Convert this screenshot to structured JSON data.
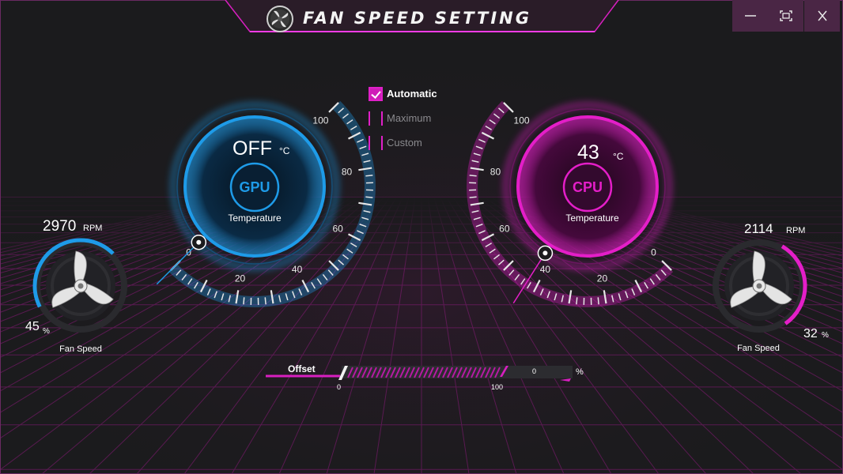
{
  "app": {
    "title": "Fan Speed Setting"
  },
  "window_controls": {
    "minimize": "—",
    "maximize": "▢",
    "close": "X"
  },
  "modes": [
    {
      "label": "Automatic",
      "checked": true
    },
    {
      "label": "Maximum",
      "checked": false
    },
    {
      "label": "Custom",
      "checked": false
    }
  ],
  "gpu": {
    "chip_label": "GPU",
    "temperature": "OFF",
    "temp_unit": "°C",
    "temperature_label": "Temperature",
    "gauge_ticks": [
      "0",
      "20",
      "40",
      "60",
      "80",
      "100"
    ],
    "needle_value": 0,
    "fan_rpm": "2970",
    "rpm_unit": "RPM",
    "fan_percent": "45",
    "percent_unit": "%",
    "fan_percent_value": 45,
    "fan_label": "Fan Speed",
    "color": "#1e9be8"
  },
  "cpu": {
    "chip_label": "CPU",
    "temperature": "43",
    "temp_unit": "°C",
    "temperature_label": "Temperature",
    "gauge_ticks": [
      "0",
      "20",
      "40",
      "60",
      "80",
      "100"
    ],
    "needle_value": 43,
    "fan_rpm": "2114",
    "rpm_unit": "RPM",
    "fan_percent": "32",
    "percent_unit": "%",
    "fan_percent_value": 32,
    "fan_label": "Fan Speed",
    "color": "#e41ec8"
  },
  "offset": {
    "label": "Offset",
    "min_label": "0",
    "max_label": "100",
    "value": "0",
    "unit": "%",
    "slider_value": 0
  }
}
